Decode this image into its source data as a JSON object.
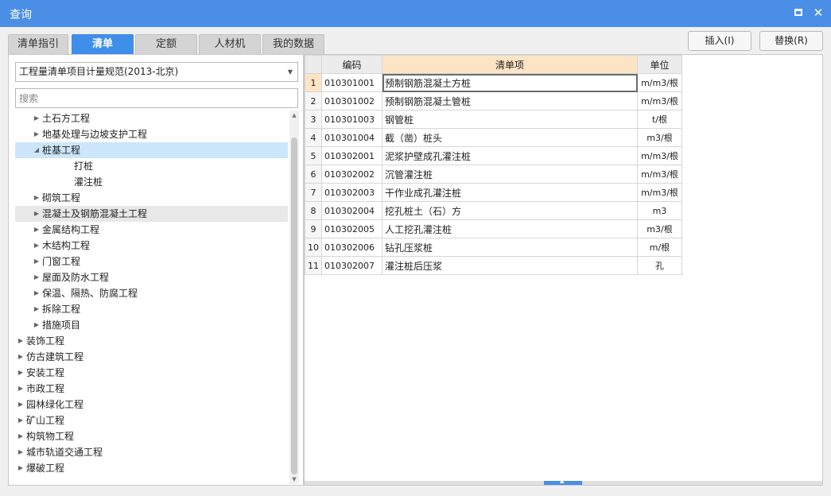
{
  "window": {
    "title": "查询"
  },
  "tabs": [
    "清单指引",
    "清单",
    "定额",
    "人材机",
    "我的数据"
  ],
  "active_tab": 1,
  "actions": {
    "insert": "插入(I)",
    "replace": "替换(R)"
  },
  "spec_dropdown": {
    "value": "工程量清单项目计量规范(2013-北京)"
  },
  "search": {
    "placeholder": "搜索"
  },
  "tree": [
    {
      "label": "土石方工程",
      "level": 1,
      "state": "collapsed"
    },
    {
      "label": "地基处理与边坡支护工程",
      "level": 1,
      "state": "collapsed"
    },
    {
      "label": "桩基工程",
      "level": 1,
      "state": "expanded",
      "selected": true
    },
    {
      "label": "打桩",
      "level": 2,
      "state": "leaf"
    },
    {
      "label": "灌注桩",
      "level": 2,
      "state": "leaf"
    },
    {
      "label": "砌筑工程",
      "level": 1,
      "state": "collapsed"
    },
    {
      "label": "混凝土及钢筋混凝土工程",
      "level": 1,
      "state": "collapsed",
      "hover": true
    },
    {
      "label": "金属结构工程",
      "level": 1,
      "state": "collapsed"
    },
    {
      "label": "木结构工程",
      "level": 1,
      "state": "collapsed"
    },
    {
      "label": "门窗工程",
      "level": 1,
      "state": "collapsed"
    },
    {
      "label": "屋面及防水工程",
      "level": 1,
      "state": "collapsed"
    },
    {
      "label": "保温、隔热、防腐工程",
      "level": 1,
      "state": "collapsed"
    },
    {
      "label": "拆除工程",
      "level": 1,
      "state": "collapsed"
    },
    {
      "label": "措施项目",
      "level": 1,
      "state": "collapsed"
    },
    {
      "label": "装饰工程",
      "level": 0,
      "state": "collapsed"
    },
    {
      "label": "仿古建筑工程",
      "level": 0,
      "state": "collapsed"
    },
    {
      "label": "安装工程",
      "level": 0,
      "state": "collapsed"
    },
    {
      "label": "市政工程",
      "level": 0,
      "state": "collapsed"
    },
    {
      "label": "园林绿化工程",
      "level": 0,
      "state": "collapsed"
    },
    {
      "label": "矿山工程",
      "level": 0,
      "state": "collapsed"
    },
    {
      "label": "构筑物工程",
      "level": 0,
      "state": "collapsed"
    },
    {
      "label": "城市轨道交通工程",
      "level": 0,
      "state": "collapsed"
    },
    {
      "label": "爆破工程",
      "level": 0,
      "state": "collapsed"
    }
  ],
  "grid": {
    "columns": [
      "",
      "编码",
      "清单项",
      "单位"
    ],
    "rows": [
      {
        "num": "1",
        "code": "010301001",
        "name": "预制钢筋混凝土方桩",
        "unit": "m/m3/根"
      },
      {
        "num": "2",
        "code": "010301002",
        "name": "预制钢筋混凝土管桩",
        "unit": "m/m3/根"
      },
      {
        "num": "3",
        "code": "010301003",
        "name": "钢管桩",
        "unit": "t/根"
      },
      {
        "num": "4",
        "code": "010301004",
        "name": "截（凿）桩头",
        "unit": "m3/根"
      },
      {
        "num": "5",
        "code": "010302001",
        "name": "泥浆护壁成孔灌注桩",
        "unit": "m/m3/根"
      },
      {
        "num": "6",
        "code": "010302002",
        "name": "沉管灌注桩",
        "unit": "m/m3/根"
      },
      {
        "num": "7",
        "code": "010302003",
        "name": "干作业成孔灌注桩",
        "unit": "m/m3/根"
      },
      {
        "num": "8",
        "code": "010302004",
        "name": "挖孔桩土（石）方",
        "unit": "m3"
      },
      {
        "num": "9",
        "code": "010302005",
        "name": "人工挖孔灌注桩",
        "unit": "m3/根"
      },
      {
        "num": "10",
        "code": "010302006",
        "name": "钻孔压浆桩",
        "unit": "m/根"
      },
      {
        "num": "11",
        "code": "010302007",
        "name": "灌注桩后压浆",
        "unit": "孔"
      }
    ]
  },
  "colors": {
    "titlebar": "#4a8ee6",
    "active_tab": "#3f8ee9",
    "selected_row": "#cce6fb",
    "header_highlight": "#fde4c4"
  }
}
